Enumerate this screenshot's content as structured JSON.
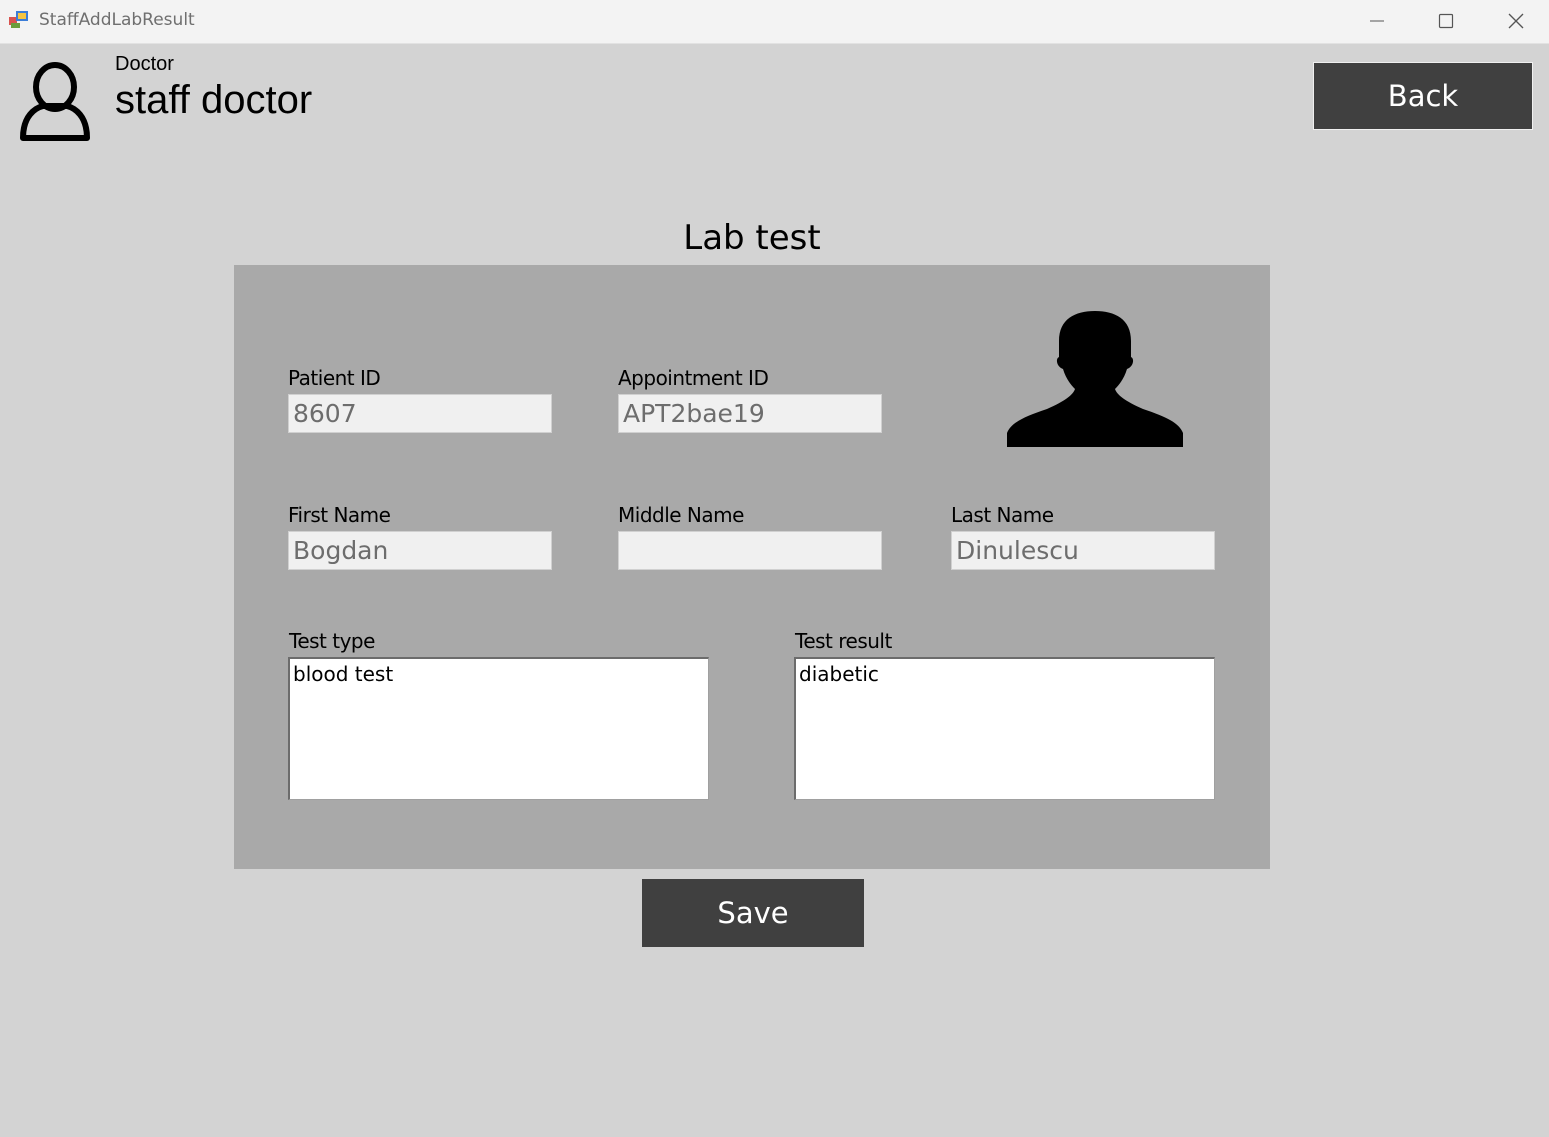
{
  "window": {
    "title": "StaffAddLabResult"
  },
  "header": {
    "role": "Doctor",
    "name": "staff doctor",
    "back_label": "Back"
  },
  "form": {
    "title": "Lab test",
    "patient_id": {
      "label": "Patient ID",
      "value": "8607"
    },
    "appointment_id": {
      "label": "Appointment ID",
      "value": "APT2bae19"
    },
    "first_name": {
      "label": "First Name",
      "value": "Bogdan"
    },
    "middle_name": {
      "label": "Middle Name",
      "value": ""
    },
    "last_name": {
      "label": "Last Name",
      "value": "Dinulescu"
    },
    "test_type": {
      "label": "Test type",
      "value": "blood test"
    },
    "test_result": {
      "label": "Test result",
      "value": "diabetic"
    },
    "save_label": "Save"
  },
  "icons": {
    "user": "user-outline-icon",
    "patient": "person-silhouette-icon"
  },
  "colors": {
    "background": "#d3d3d3",
    "panel": "#a9a9a9",
    "button": "#404040",
    "button_text": "#ffffff"
  }
}
